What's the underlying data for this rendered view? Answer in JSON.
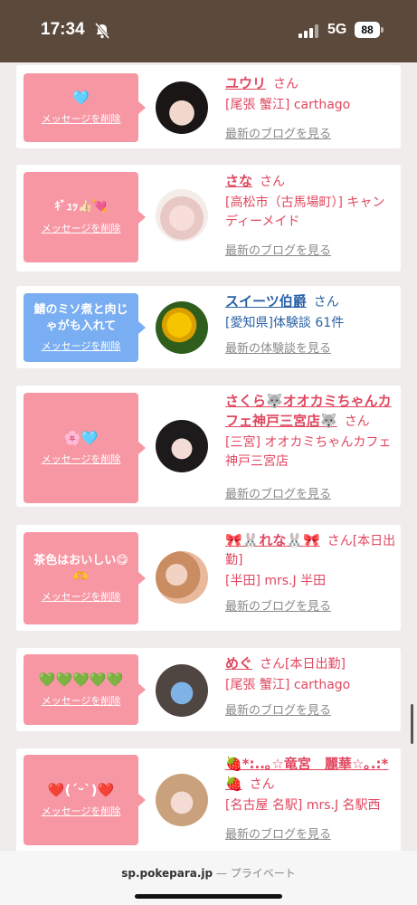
{
  "status_bar": {
    "time": "17:34",
    "network": "5G",
    "battery": "88"
  },
  "cards": [
    {
      "message": "🩵",
      "delete": "メッセージを削除",
      "name": "ユウリ",
      "suffix": "さん",
      "location": "[尾張 蟹江] carthago",
      "link": "最新のブログを見る"
    },
    {
      "message": "ｷﾞｭｯ👍🏻💘",
      "delete": "メッセージを削除",
      "name": "さな",
      "suffix": "さん",
      "location": "[高松市（古馬場町）] キャンディーメイド",
      "link": "最新のブログを見る"
    },
    {
      "message": "鯖のミソ煮と肉じゃがも入れて",
      "delete": "メッセージを削除",
      "name": "スイーツ伯爵",
      "suffix": "さん",
      "location": "[愛知県]体験談 61件",
      "link": "最新の体験談を見る"
    },
    {
      "message": "🌸🩵",
      "delete": "メッセージを削除",
      "name": "さくら🐺オオカミちゃんカフェ神戸三宮店🐺",
      "suffix": "さん",
      "location": "[三宮] オオカミちゃんカフェ神戸三宮店",
      "link": "最新のブログを見る"
    },
    {
      "message": "茶色はおいしい😋🫶",
      "delete": "メッセージを削除",
      "name": "🎀🐰れな🐰🎀",
      "suffix": "さん[本日出勤]",
      "location": "[半田] mrs.J 半田",
      "link": "最新のブログを見る"
    },
    {
      "message": "💚💚💚💚💚",
      "delete": "メッセージを削除",
      "name": "めぐ",
      "suffix": "さん[本日出勤]",
      "location": "[尾張 蟹江] carthago",
      "link": "最新のブログを見る"
    },
    {
      "message": "❤️(ˊᵕˋ)❤️",
      "delete": "メッセージを削除",
      "name": "🍓*:..｡☆竜宮　麗華☆｡.:*🍓",
      "suffix": "さん",
      "location": "[名古屋 名駅] mrs.J 名駅西",
      "link": "最新のブログを見る"
    }
  ],
  "browser": {
    "domain": "sp.pokepara.jp",
    "separator": "—",
    "mode": "プライベート"
  },
  "colors": {
    "pink_message": "#f797a4",
    "blue_message": "#79aef2",
    "name_pink": "#e0475f",
    "name_blue": "#2a62a6",
    "status_bar": "#5b4a3c"
  }
}
